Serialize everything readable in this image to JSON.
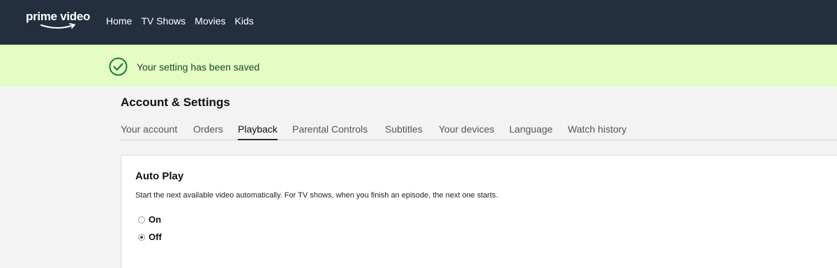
{
  "brand": {
    "name": "prime video"
  },
  "nav": {
    "items": [
      "Home",
      "TV Shows",
      "Movies",
      "Kids"
    ]
  },
  "banner": {
    "message": "Your setting has been saved"
  },
  "page": {
    "title": "Account & Settings"
  },
  "tabs": [
    {
      "label": "Your account",
      "active": false
    },
    {
      "label": "Orders",
      "active": false
    },
    {
      "label": "Playback",
      "active": true
    },
    {
      "label": "Parental Controls",
      "active": false
    },
    {
      "label": "Subtitles",
      "active": false
    },
    {
      "label": "Your devices",
      "active": false
    },
    {
      "label": "Language",
      "active": false
    },
    {
      "label": "Watch history",
      "active": false
    }
  ],
  "autoplay": {
    "title": "Auto Play",
    "description": "Start the next available video automatically. For TV shows, when you finish an episode, the next one starts.",
    "options": [
      {
        "label": "On",
        "selected": false
      },
      {
        "label": "Off",
        "selected": true
      }
    ]
  },
  "colors": {
    "topbar": "#232f3e",
    "banner": "#e5fcc2",
    "success": "#1a7a3a"
  }
}
